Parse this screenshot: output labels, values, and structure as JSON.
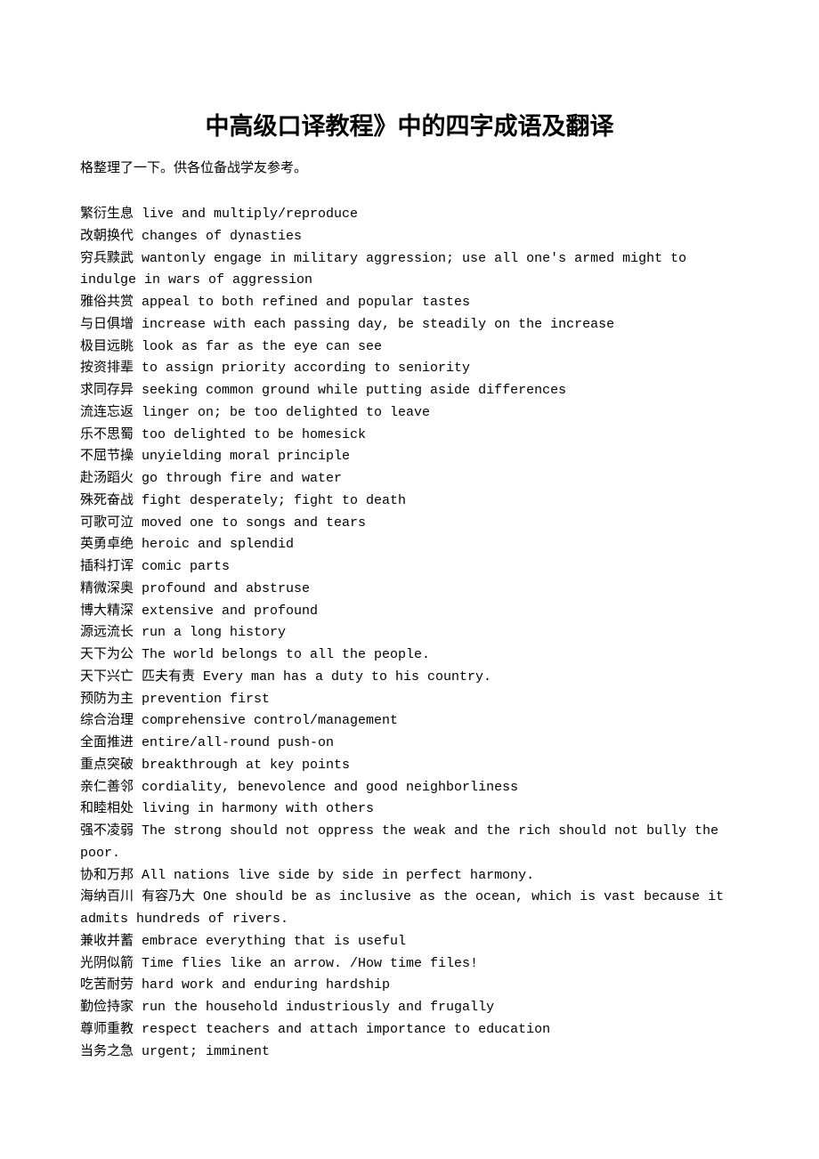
{
  "title": "中高级口译教程》中的四字成语及翻译",
  "intro": "格整理了一下。供各位备战学友参考。",
  "entries": [
    "繁衍生息 live and multiply/reproduce",
    "改朝换代 changes of dynasties",
    "穷兵黩武 wantonly engage in military aggression; use all one's armed might to indulge in wars of aggression",
    "雅俗共赏 appeal to both refined and popular tastes",
    "与日俱增 increase with each passing day, be steadily on the increase",
    "极目远眺 look as far as the eye can see",
    "按资排辈 to assign priority according to seniority",
    "求同存异 seeking common ground while putting aside differences",
    "流连忘返 linger on; be too delighted to leave",
    "乐不思蜀 too delighted to be homesick",
    "不屈节操 unyielding moral principle",
    "赴汤蹈火 go through fire and water",
    "殊死奋战 fight desperately; fight to death",
    "可歌可泣 moved one to songs and tears",
    "英勇卓绝 heroic and splendid",
    "插科打诨 comic parts",
    "精微深奥 profound and abstruse",
    "博大精深 extensive and profound",
    "源远流长 run a long history",
    "天下为公 The world belongs to all the people.",
    "天下兴亡 匹夫有责 Every man has a duty to his country.",
    "预防为主 prevention first",
    "综合治理 comprehensive control/management",
    "全面推进 entire/all-round push-on",
    "重点突破 breakthrough at key points",
    "亲仁善邻 cordiality, benevolence and good neighborliness",
    "和睦相处 living in harmony with others",
    "强不凌弱 The strong should not oppress the weak and the rich should not bully the poor.",
    "协和万邦 All nations live side by side in perfect harmony.",
    "海纳百川 有容乃大 One should be as inclusive as the ocean, which is vast because it admits hundreds of rivers.",
    "兼收并蓄 embrace everything that is useful",
    "光阴似箭 Time flies like an arrow. /How time files!",
    "吃苦耐劳 hard work and enduring hardship",
    "勤俭持家 run the household industriously and frugally",
    "尊师重教 respect teachers and attach importance to education",
    "当务之急 urgent; imminent"
  ]
}
